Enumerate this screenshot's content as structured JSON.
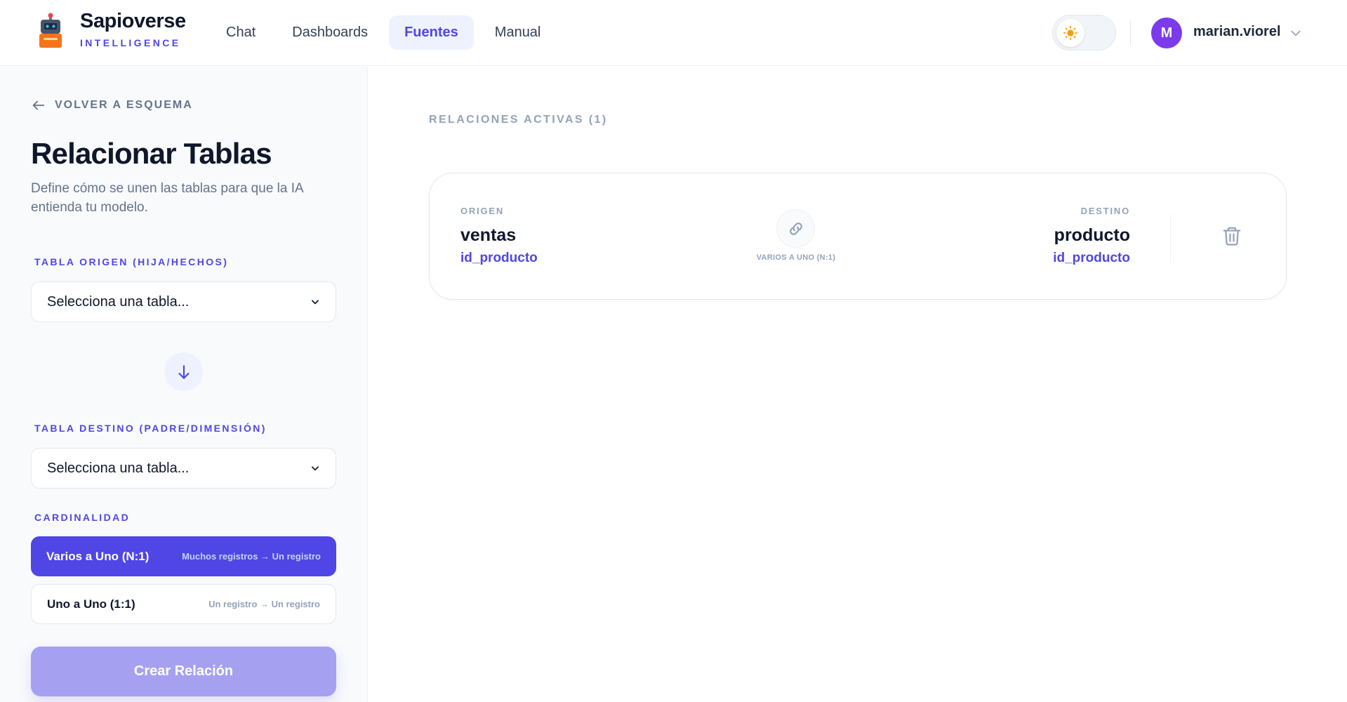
{
  "header": {
    "brand_name": "Sapioverse",
    "brand_sub": "INTELLIGENCE",
    "nav": [
      {
        "label": "Chat",
        "active": false
      },
      {
        "label": "Dashboards",
        "active": false
      },
      {
        "label": "Fuentes",
        "active": true
      },
      {
        "label": "Manual",
        "active": false
      }
    ],
    "theme_icon": "sun-icon",
    "user": {
      "initial": "M",
      "name": "marian.viorel"
    }
  },
  "sidebar": {
    "back_label": "VOLVER A ESQUEMA",
    "title": "Relacionar Tablas",
    "description": "Define cómo se unen las tablas para que la IA entienda tu modelo.",
    "origin_label": "TABLA ORIGEN (HIJA/HECHOS)",
    "origin_value": "Selecciona una tabla...",
    "target_label": "TABLA DESTINO (PADRE/DIMENSIÓN)",
    "target_value": "Selecciona una tabla...",
    "cardinality_label": "CARDINALIDAD",
    "cardinality_options": [
      {
        "title": "Varios a Uno (N:1)",
        "hint": "Muchos registros → Un registro",
        "selected": true
      },
      {
        "title": "Uno a Uno (1:1)",
        "hint": "Un registro → Un registro",
        "selected": false
      }
    ],
    "create_button": "Crear Relación"
  },
  "main": {
    "section_label": "RELACIONES ACTIVAS (1)",
    "relations": [
      {
        "origin_label": "ORIGEN",
        "origin_table": "ventas",
        "origin_column": "id_producto",
        "cardinality": "VARIOS A UNO (N:1)",
        "target_label": "DESTINO",
        "target_table": "producto",
        "target_column": "id_producto"
      }
    ]
  },
  "colors": {
    "accent": "#4f46e5",
    "avatar": "#7c3aed",
    "button_disabled": "#a5a1f0"
  }
}
